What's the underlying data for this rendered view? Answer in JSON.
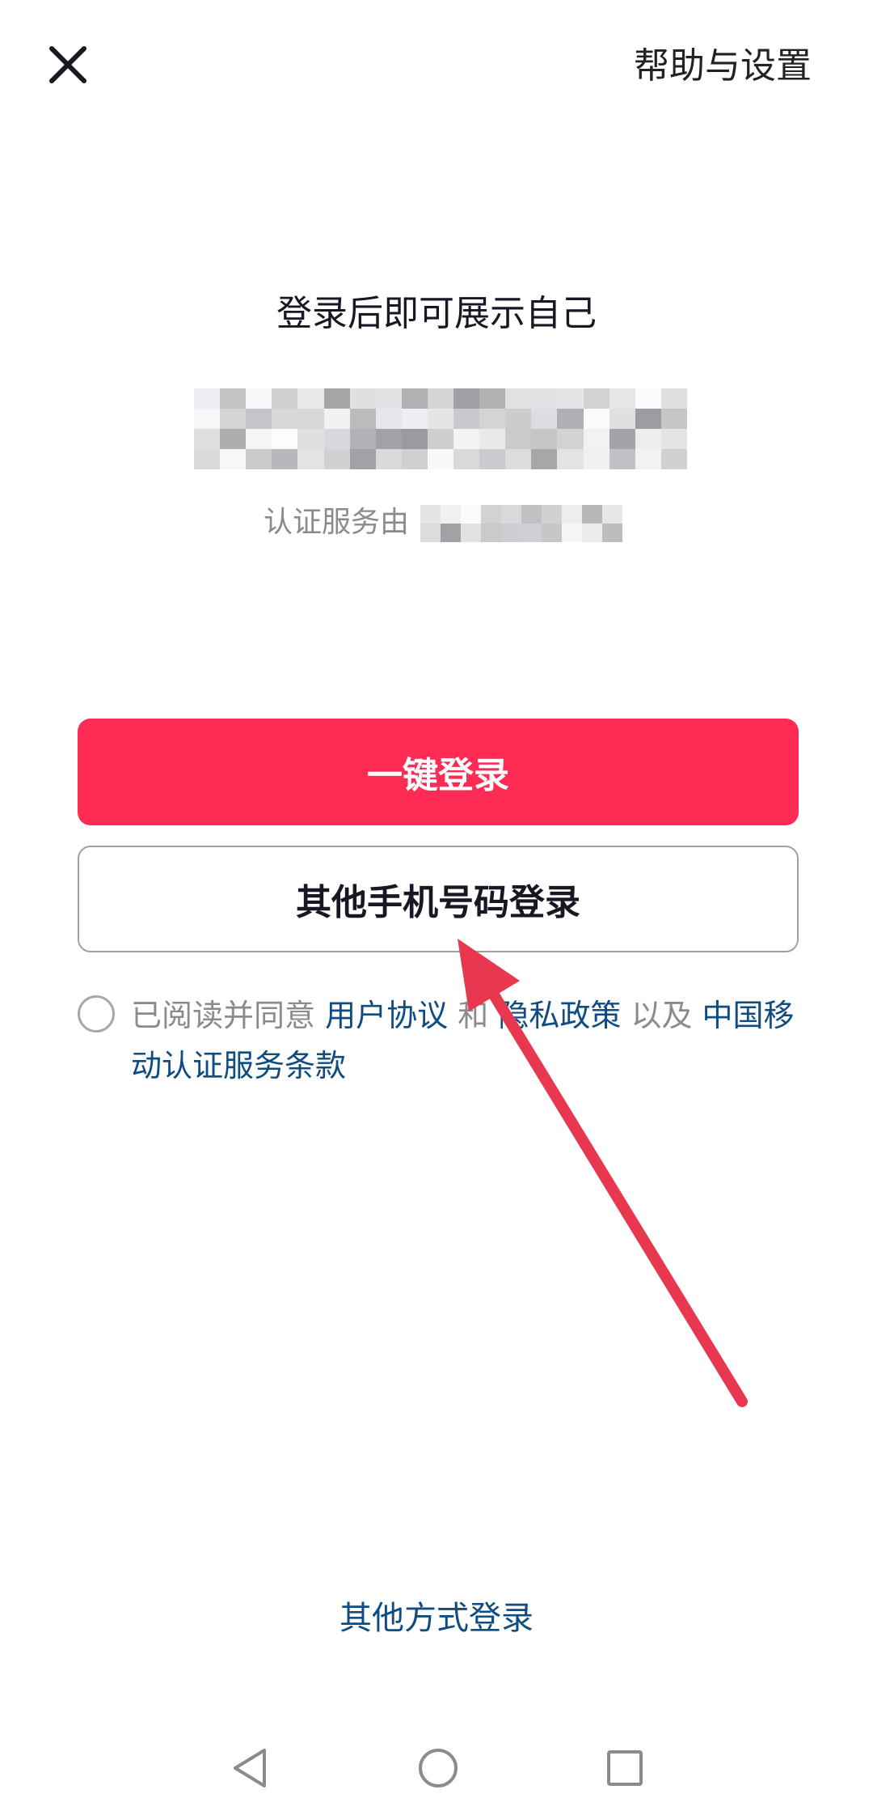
{
  "top_bar": {
    "close_icon": "close-icon",
    "help_label": "帮助与设置"
  },
  "hero": {
    "title": "登录后即可展示自己",
    "auth_prefix": "认证服务由"
  },
  "buttons": {
    "one_click_login": "一键登录",
    "other_phone_login": "其他手机号码登录"
  },
  "agreement": {
    "prefix": "已阅读并同意",
    "user_agreement": "用户协议",
    "and": "和",
    "privacy_policy": "隐私政策",
    "as_well_as": "以及",
    "carrier_terms": "中国移动认证服务条款"
  },
  "footer": {
    "other_methods": "其他方式登录"
  },
  "nav": {
    "back_icon": "back-triangle-icon",
    "home_icon": "home-circle-icon",
    "recents_icon": "recents-square-icon"
  },
  "colors": {
    "primary": "#fe2c55",
    "link": "#0f4c81",
    "text": "#161823",
    "muted": "#8a8b91",
    "annotation_arrow": "#e8384f"
  }
}
